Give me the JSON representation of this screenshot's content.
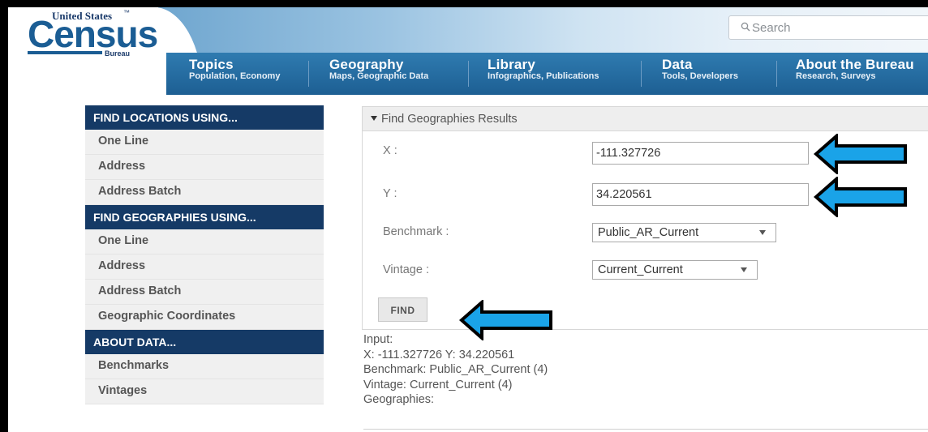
{
  "header": {
    "logo": {
      "line1": "United States",
      "tm": "™",
      "main": "Census",
      "sub": "Bureau"
    },
    "search_placeholder": "Search",
    "nav": [
      {
        "title": "Topics",
        "subtitle": "Population, Economy"
      },
      {
        "title": "Geography",
        "subtitle": "Maps, Geographic Data"
      },
      {
        "title": "Library",
        "subtitle": "Infographics, Publications"
      },
      {
        "title": "Data",
        "subtitle": "Tools, Developers"
      },
      {
        "title": "About the Bureau",
        "subtitle": "Research, Surveys"
      }
    ]
  },
  "sidebar": {
    "sections": [
      {
        "heading": "FIND LOCATIONS USING...",
        "items": [
          "One Line",
          "Address",
          "Address Batch"
        ]
      },
      {
        "heading": "FIND GEOGRAPHIES USING...",
        "items": [
          "One Line",
          "Address",
          "Address Batch",
          "Geographic Coordinates"
        ]
      },
      {
        "heading": "ABOUT DATA...",
        "items": [
          "Benchmarks",
          "Vintages"
        ]
      }
    ]
  },
  "form": {
    "section_title": "Find Geographies Results",
    "x_label": "X :",
    "x_value": "-111.327726",
    "y_label": "Y :",
    "y_value": "34.220561",
    "benchmark_label": "Benchmark :",
    "benchmark_value": "Public_AR_Current",
    "vintage_label": "Vintage :",
    "vintage_value": "Current_Current",
    "find_label": "FIND"
  },
  "output": {
    "lines": [
      "Input:",
      "X: -111.327726 Y: 34.220561",
      "Benchmark: Public_AR_Current (4)",
      "Vintage: Current_Current (4)",
      "Geographies:"
    ]
  },
  "colors": {
    "navbar": "#1d5f93",
    "sidebar_heading": "#153a66",
    "annotation_arrow": "#1aa3e8"
  }
}
